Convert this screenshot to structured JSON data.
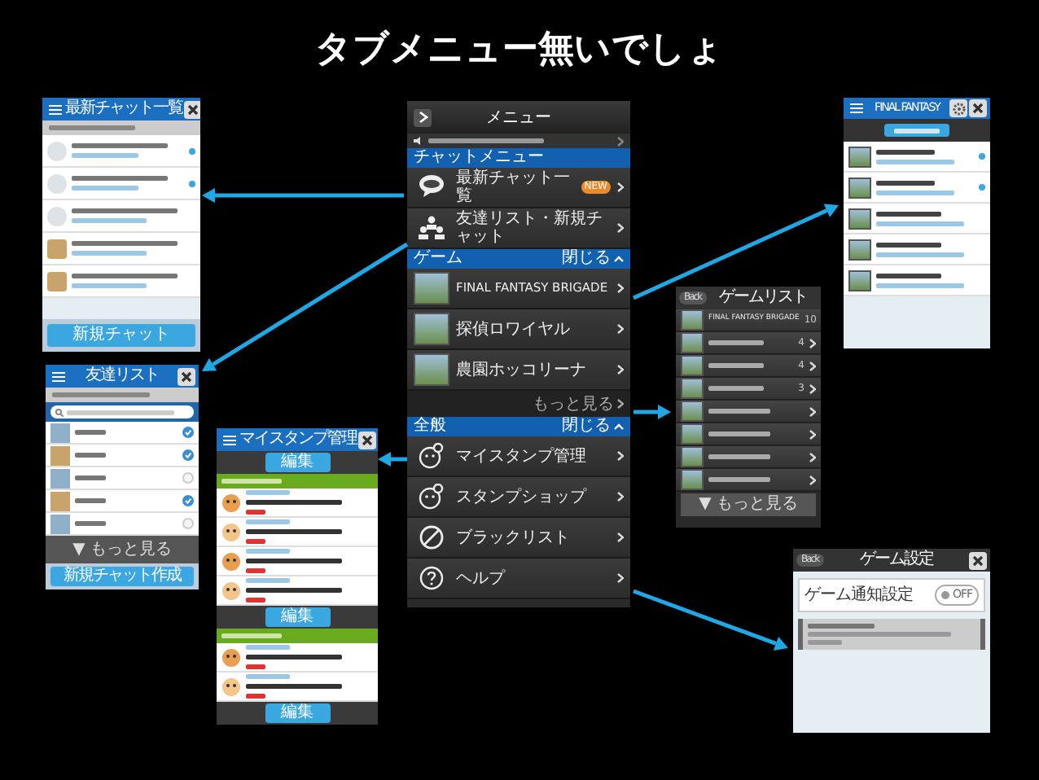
{
  "slide_title": "タブメニュー無いでしょ",
  "menu": {
    "title": "メニュー",
    "sections": [
      {
        "label": "チャットメニュー",
        "items": [
          {
            "label": "最新チャット一覧",
            "kind": "chat",
            "badge": "NEW"
          },
          {
            "label": "友達リスト・新規チャット",
            "kind": "people"
          }
        ]
      },
      {
        "label": "ゲーム",
        "toggle": "閉じる",
        "items": [
          {
            "label": "FINAL FANTASY BRIGADE",
            "kind": "game"
          },
          {
            "label": "探偵ロワイヤル",
            "kind": "game"
          },
          {
            "label": "農園ホッコリーナ",
            "kind": "game"
          }
        ],
        "more": "もっと見る"
      },
      {
        "label": "全般",
        "toggle": "閉じる",
        "items": [
          {
            "label": "マイスタンプ管理",
            "kind": "stamp"
          },
          {
            "label": "スタンプショップ",
            "kind": "stamp"
          },
          {
            "label": "ブラックリスト",
            "kind": "ban"
          },
          {
            "label": "ヘルプ",
            "kind": "help"
          }
        ]
      }
    ]
  },
  "chat_list": {
    "title": "最新チャット一覧",
    "rows": [
      {
        "kind": "group",
        "unread": true
      },
      {
        "kind": "group",
        "unread": true
      },
      {
        "kind": "group",
        "unread": false
      },
      {
        "kind": "user",
        "unread": false
      },
      {
        "kind": "user",
        "unread": false
      }
    ],
    "button": "新規チャット"
  },
  "friend_list": {
    "title": "友達リスト",
    "rows": [
      {
        "checked": true
      },
      {
        "checked": true
      },
      {
        "checked": false
      },
      {
        "checked": true
      },
      {
        "checked": false
      }
    ],
    "more": "▼ もっと見る",
    "button": "新規チャット作成"
  },
  "stamps": {
    "title": "マイスタンプ管理",
    "blocks": [
      {
        "kind": "button",
        "label": "編集"
      },
      {
        "kind": "section"
      },
      {
        "kind": "stamp"
      },
      {
        "kind": "stamp"
      },
      {
        "kind": "stamp"
      },
      {
        "kind": "stamp"
      },
      {
        "kind": "button",
        "label": "編集"
      },
      {
        "kind": "section"
      },
      {
        "kind": "stamp"
      },
      {
        "kind": "stamp"
      },
      {
        "kind": "button",
        "label": "編集"
      }
    ]
  },
  "game_feed": {
    "title": "FINAL FANTASY",
    "rows": [
      {
        "unread": true
      },
      {
        "unread": true
      },
      {
        "unread": false
      },
      {
        "unread": false
      },
      {
        "unread": false
      }
    ]
  },
  "game_list": {
    "back": "Back",
    "title": "ゲームリスト",
    "rows": [
      {
        "label": "FINAL FANTASY BRIGADE",
        "count": "10"
      },
      {
        "count": "4"
      },
      {
        "count": "4"
      },
      {
        "count": "3"
      },
      {},
      {},
      {},
      {}
    ],
    "more": "▼ もっと見る"
  },
  "game_settings": {
    "back": "Back",
    "title": "ゲーム設定",
    "setting": {
      "label": "ゲーム通知設定",
      "value": "OFF",
      "on": false
    }
  }
}
